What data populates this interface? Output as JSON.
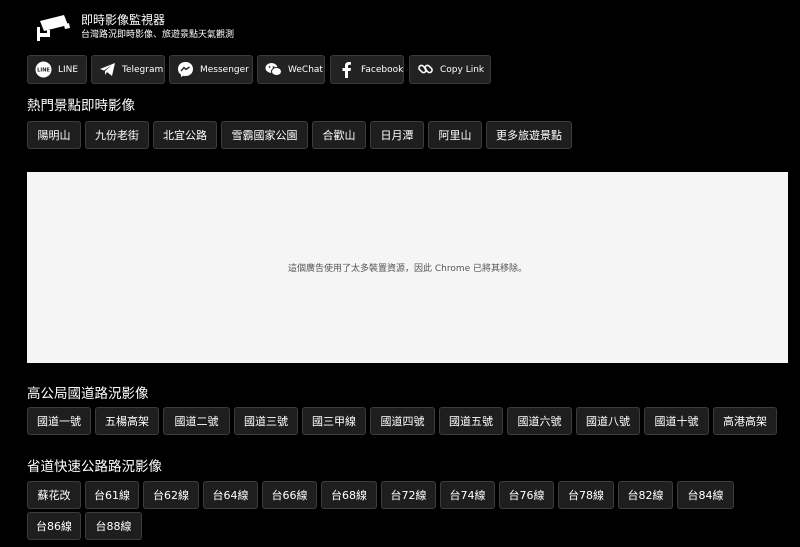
{
  "header": {
    "title": "即時影像監視器",
    "subtitle": "台灣路況即時影像、旅遊景點天氣觀測",
    "logo_icon": "cctv-camera-icon"
  },
  "share": [
    {
      "label": "LINE",
      "icon": "line-icon"
    },
    {
      "label": "Telegram",
      "icon": "telegram-icon"
    },
    {
      "label": "Messenger",
      "icon": "messenger-icon"
    },
    {
      "label": "WeChat",
      "icon": "wechat-icon"
    },
    {
      "label": "Facebook",
      "icon": "facebook-icon"
    },
    {
      "label": "Copy Link",
      "icon": "link-icon"
    }
  ],
  "sections": {
    "spots": {
      "title": "熱門景點即時影像",
      "items": [
        "陽明山",
        "九份老街",
        "北宜公路",
        "雪霸國家公園",
        "合歡山",
        "日月潭",
        "阿里山",
        "更多旅遊景點"
      ]
    },
    "freeway": {
      "title": "高公局國道路況影像",
      "items": [
        "國道一號",
        "五楊高架",
        "國道二號",
        "國道三號",
        "國三甲線",
        "國道四號",
        "國道五號",
        "國道六號",
        "國道八號",
        "國道十號",
        "高港高架"
      ]
    },
    "provincial": {
      "title": "省道快速公路路況影像",
      "items": [
        "蘇花改",
        "台61線",
        "台62線",
        "台64線",
        "台66線",
        "台68線",
        "台72線",
        "台74線",
        "台76線",
        "台78線",
        "台82線",
        "台84線",
        "台86線",
        "台88線"
      ]
    }
  },
  "ad_notice": "這個廣告使用了太多裝置資源，因此 Chrome 已將其移除。"
}
